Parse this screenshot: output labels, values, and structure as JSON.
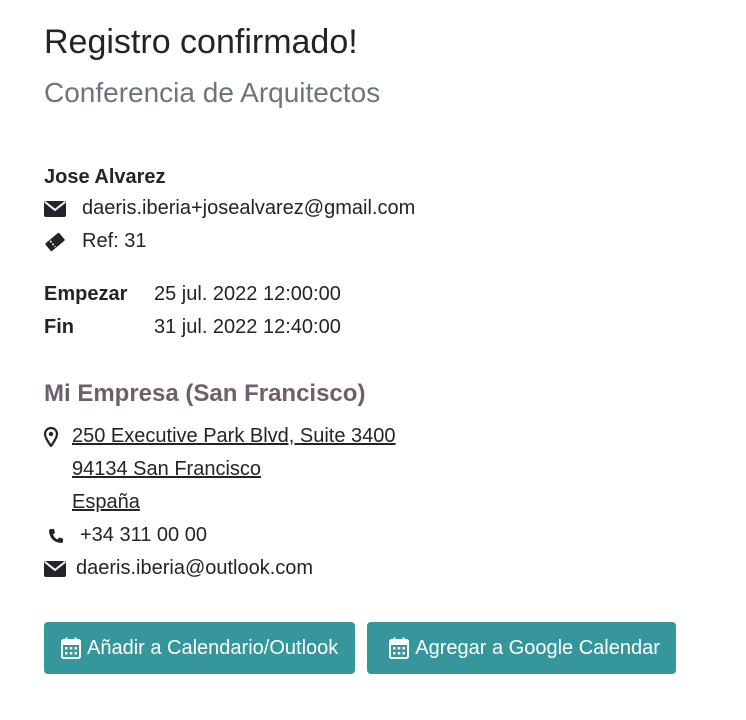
{
  "header": {
    "title": "Registro confirmado!",
    "event_name": "Conferencia de Arquitectos"
  },
  "attendee": {
    "name": "Jose Alvarez",
    "email": "daeris.iberia+josealvarez@gmail.com",
    "ref": "Ref: 31"
  },
  "dates": {
    "start_label": "Empezar",
    "start_value": "25 jul. 2022 12:00:00",
    "end_label": "Fin",
    "end_value": "31 jul. 2022 12:40:00"
  },
  "company": {
    "name": "Mi Empresa (San Francisco)",
    "address_line1": "250 Executive Park Blvd, Suite 3400",
    "address_line2": "94134 San Francisco",
    "address_line3": "España",
    "phone": "+34 311 00 00",
    "email": "daeris.iberia@outlook.com"
  },
  "actions": {
    "outlook_label": "Añadir a Calendario/Outlook",
    "google_label": "Agregar a Google Calendar"
  },
  "colors": {
    "button_bg": "#35979c",
    "company_color": "#6d5f6b",
    "subtitle_color": "#6c757d"
  }
}
